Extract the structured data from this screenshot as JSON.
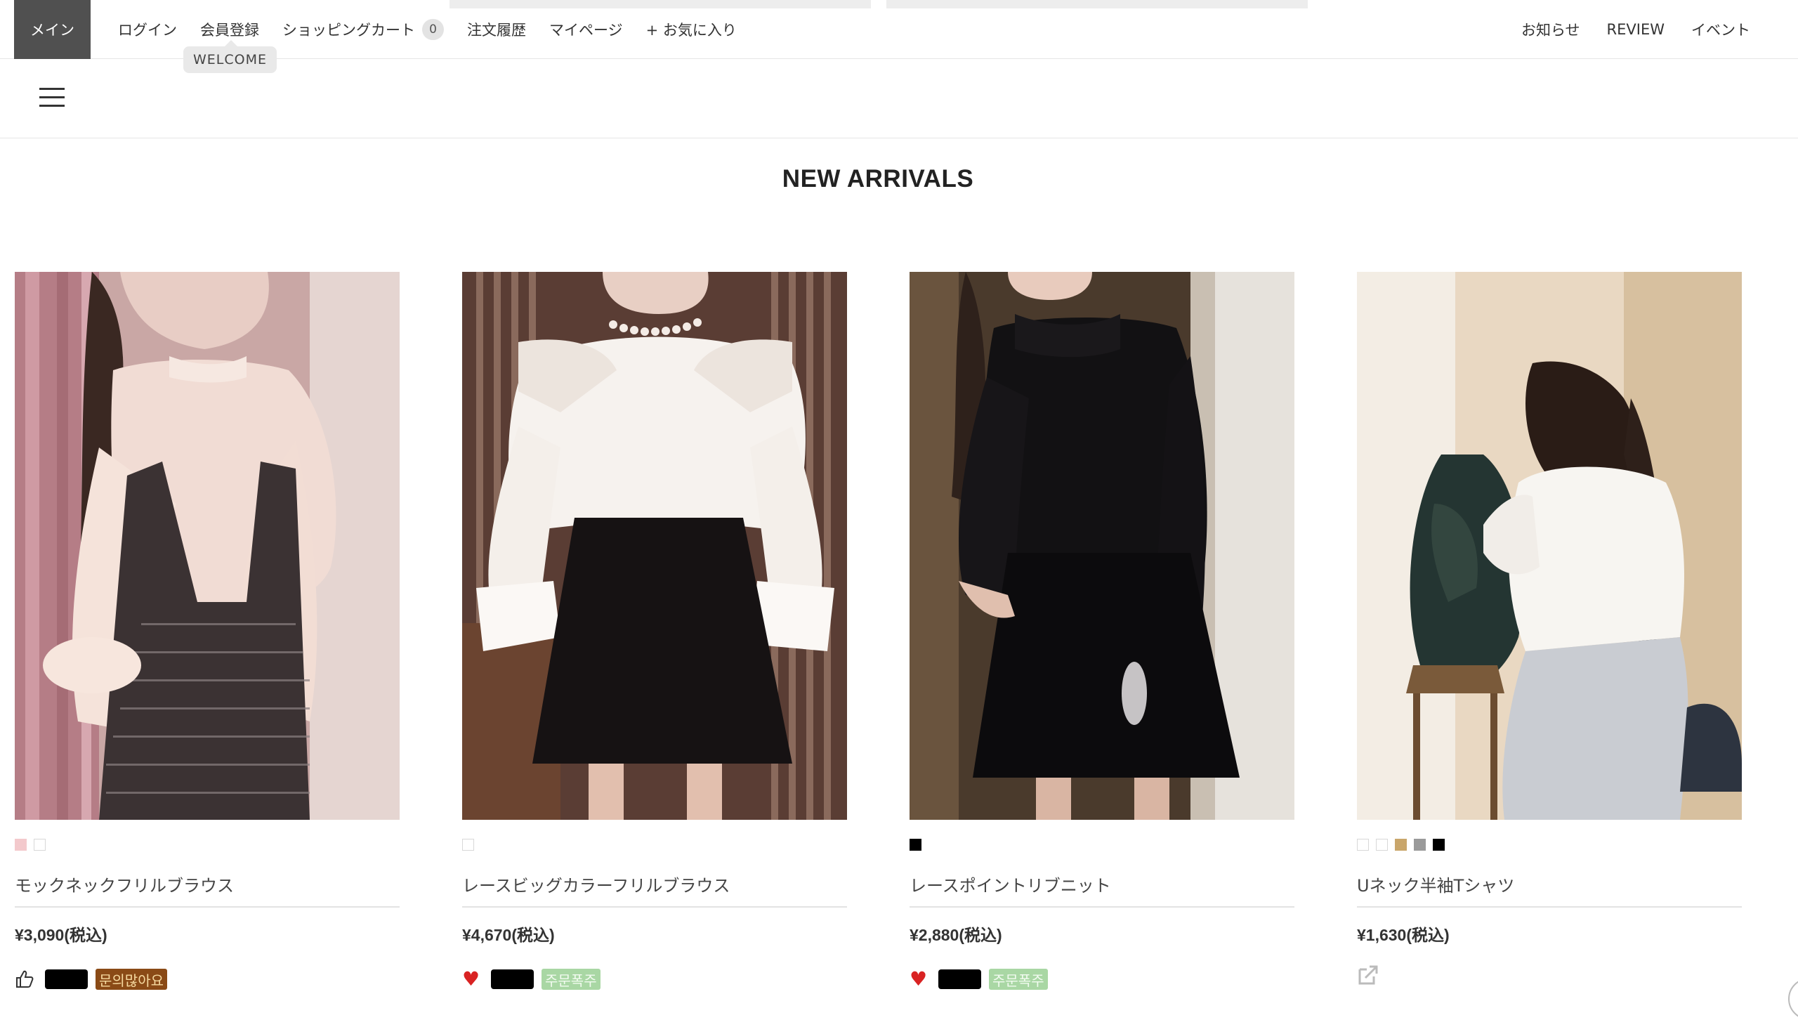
{
  "topbar": {
    "main_tab": "メイン",
    "nav_left": {
      "login": "ログイン",
      "register": "会員登録",
      "cart": "ショッピングカート",
      "cart_count": "0",
      "orders": "注文履歴",
      "mypage": "マイページ",
      "favorites": "+ お気に入り"
    },
    "welcome_tooltip": "WELCOME",
    "nav_right": {
      "news": "お知らせ",
      "review": "REVIEW",
      "event": "イベント"
    }
  },
  "menu_icon": "hamburger-menu-icon",
  "section_title": "NEW ARRIVALS",
  "products": [
    {
      "name": "モックネックフリルブラウス",
      "price": "¥3,090(税込)",
      "swatches": [
        "#f3c9cc",
        "#ffffff"
      ],
      "badges": {
        "icon": "thumbs-up-icon",
        "label": "문의많아요"
      }
    },
    {
      "name": "レースビッグカラーフリルブラウス",
      "price": "¥4,670(税込)",
      "swatches": [
        "#ffffff"
      ],
      "badges": {
        "icon": "heart-icon",
        "label": "주문폭주"
      }
    },
    {
      "name": "レースポイントリブニット",
      "price": "¥2,880(税込)",
      "swatches": [
        "#000000"
      ],
      "badges": {
        "icon": "heart-icon",
        "label": "주문폭주"
      }
    },
    {
      "name": "Uネック半袖Tシャツ",
      "price": "¥1,630(税込)",
      "swatches": [
        "#ffffff",
        "#ffffff",
        "#c9a66b",
        "#9a9a9a",
        "#000000"
      ],
      "badges": {
        "icon": "share-icon"
      }
    }
  ],
  "colors": {
    "main_tab_bg": "#505050",
    "badge_brown": "#8a4a16",
    "badge_green": "#a9d7a4",
    "heart": "#d92323"
  }
}
